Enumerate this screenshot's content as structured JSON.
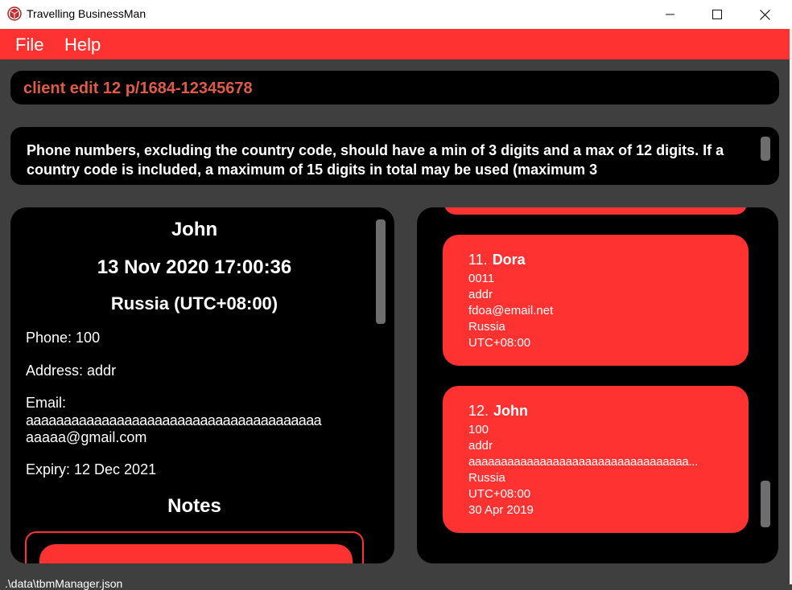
{
  "window": {
    "title": "Travelling BusinessMan"
  },
  "menu": {
    "file": "File",
    "help": "Help"
  },
  "command": {
    "value": "client edit 12 p/1684-12345678"
  },
  "result": {
    "text": "Phone numbers, excluding the country code, should have a min of 3 digits and a max of 12 digits. If a country code is included, a maximum of 15 digits in total may be used (maximum 3"
  },
  "detail": {
    "name": "John",
    "datetime": "13 Nov 2020 17:00:36",
    "country": "Russia (UTC+08:00)",
    "phone": "Phone: 100",
    "address": "Address: addr",
    "email_label": "Email:",
    "email_line1": "aaaaaaaaaaaaaaaaaaaaaaaaaaaaaaaaaaaaaaa",
    "email_line2": "aaaaa@gmail.com",
    "expiry": "Expiry: 12 Dec 2021",
    "notes_heading": "Notes"
  },
  "clients": [
    {
      "index": "11.",
      "name": "Dora",
      "phone": "0011",
      "address": "addr",
      "email": "fdoa@email.net",
      "country": "Russia",
      "timezone": "UTC+08:00"
    },
    {
      "index": "12.",
      "name": "John",
      "phone": "100",
      "address": "addr",
      "email": "aaaaaaaaaaaaaaaaaaaaaaaaaaaaaaaaaa...",
      "country": "Russia",
      "timezone": "UTC+08:00",
      "expiry": "30 Apr 2019"
    }
  ],
  "status": {
    "path": ".\\data\\tbmManager.json"
  },
  "colors": {
    "accent": "#ff3232",
    "background": "#3f3f3f",
    "panel": "#000000",
    "command_text": "#e05a45"
  }
}
